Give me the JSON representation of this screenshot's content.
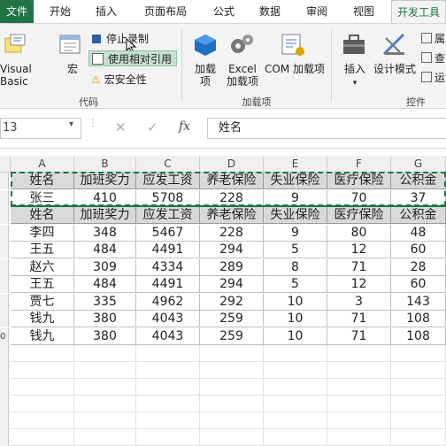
{
  "tabs": [
    "文件",
    "开始",
    "插入",
    "页面布局",
    "公式",
    "数据",
    "审阅",
    "视图",
    "开发工具"
  ],
  "ribbon": {
    "code": {
      "visual_basic": "Visual Basic",
      "macro": "宏",
      "stop_recording": "停止录制",
      "relative_ref": "使用相对引用",
      "macro_security": "宏安全性",
      "label": "代码"
    },
    "addins": {
      "addin": "加载项",
      "excel_addin": "Excel 加载项",
      "com_addin": "COM 加载项",
      "label": "加载项"
    },
    "controls": {
      "insert": "插入",
      "design_mode": "设计模式",
      "properties": "属",
      "view_code": "查",
      "run_dialog": "运",
      "label": "控件"
    }
  },
  "formula_bar": {
    "name_box": "13",
    "formula": "姓名",
    "fx": "fx"
  },
  "columns": [
    "A",
    "B",
    "C",
    "D",
    "E",
    "F",
    "G"
  ],
  "rows": [
    {
      "cells": [
        "姓名",
        "加班奖力",
        "应发工资",
        "养老保险",
        "失业保险",
        "医疗保险",
        "公积金"
      ],
      "header": true
    },
    {
      "cells": [
        "张三",
        "410",
        "5708",
        "228",
        "9",
        "70",
        "37"
      ],
      "header": false
    },
    {
      "cells": [
        "姓名",
        "加班奖力",
        "应发工资",
        "养老保险",
        "失业保险",
        "医疗保险",
        "公积金"
      ],
      "header": true
    },
    {
      "cells": [
        "李四",
        "348",
        "5467",
        "228",
        "9",
        "80",
        "48"
      ],
      "header": false
    },
    {
      "cells": [
        "王五",
        "484",
        "4491",
        "294",
        "5",
        "12",
        "60"
      ],
      "header": false
    },
    {
      "cells": [
        "赵六",
        "309",
        "4334",
        "289",
        "8",
        "71",
        "28"
      ],
      "header": false
    },
    {
      "cells": [
        "王五",
        "484",
        "4491",
        "294",
        "5",
        "12",
        "60"
      ],
      "header": false
    },
    {
      "cells": [
        "贾七",
        "335",
        "4962",
        "292",
        "10",
        "3",
        "143"
      ],
      "header": false
    },
    {
      "cells": [
        "钱九",
        "380",
        "4043",
        "259",
        "10",
        "71",
        "108"
      ],
      "header": false
    },
    {
      "cells": [
        "钱九",
        "380",
        "4043",
        "259",
        "10",
        "71",
        "108"
      ],
      "header": false
    }
  ],
  "row_numbers": [
    "",
    "",
    "",
    "",
    "",
    "",
    "",
    "",
    "",
    "0"
  ],
  "colors": {
    "accent": "#217346",
    "header_fill": "#d9d9d9",
    "highlight": "#c5e1d0"
  }
}
